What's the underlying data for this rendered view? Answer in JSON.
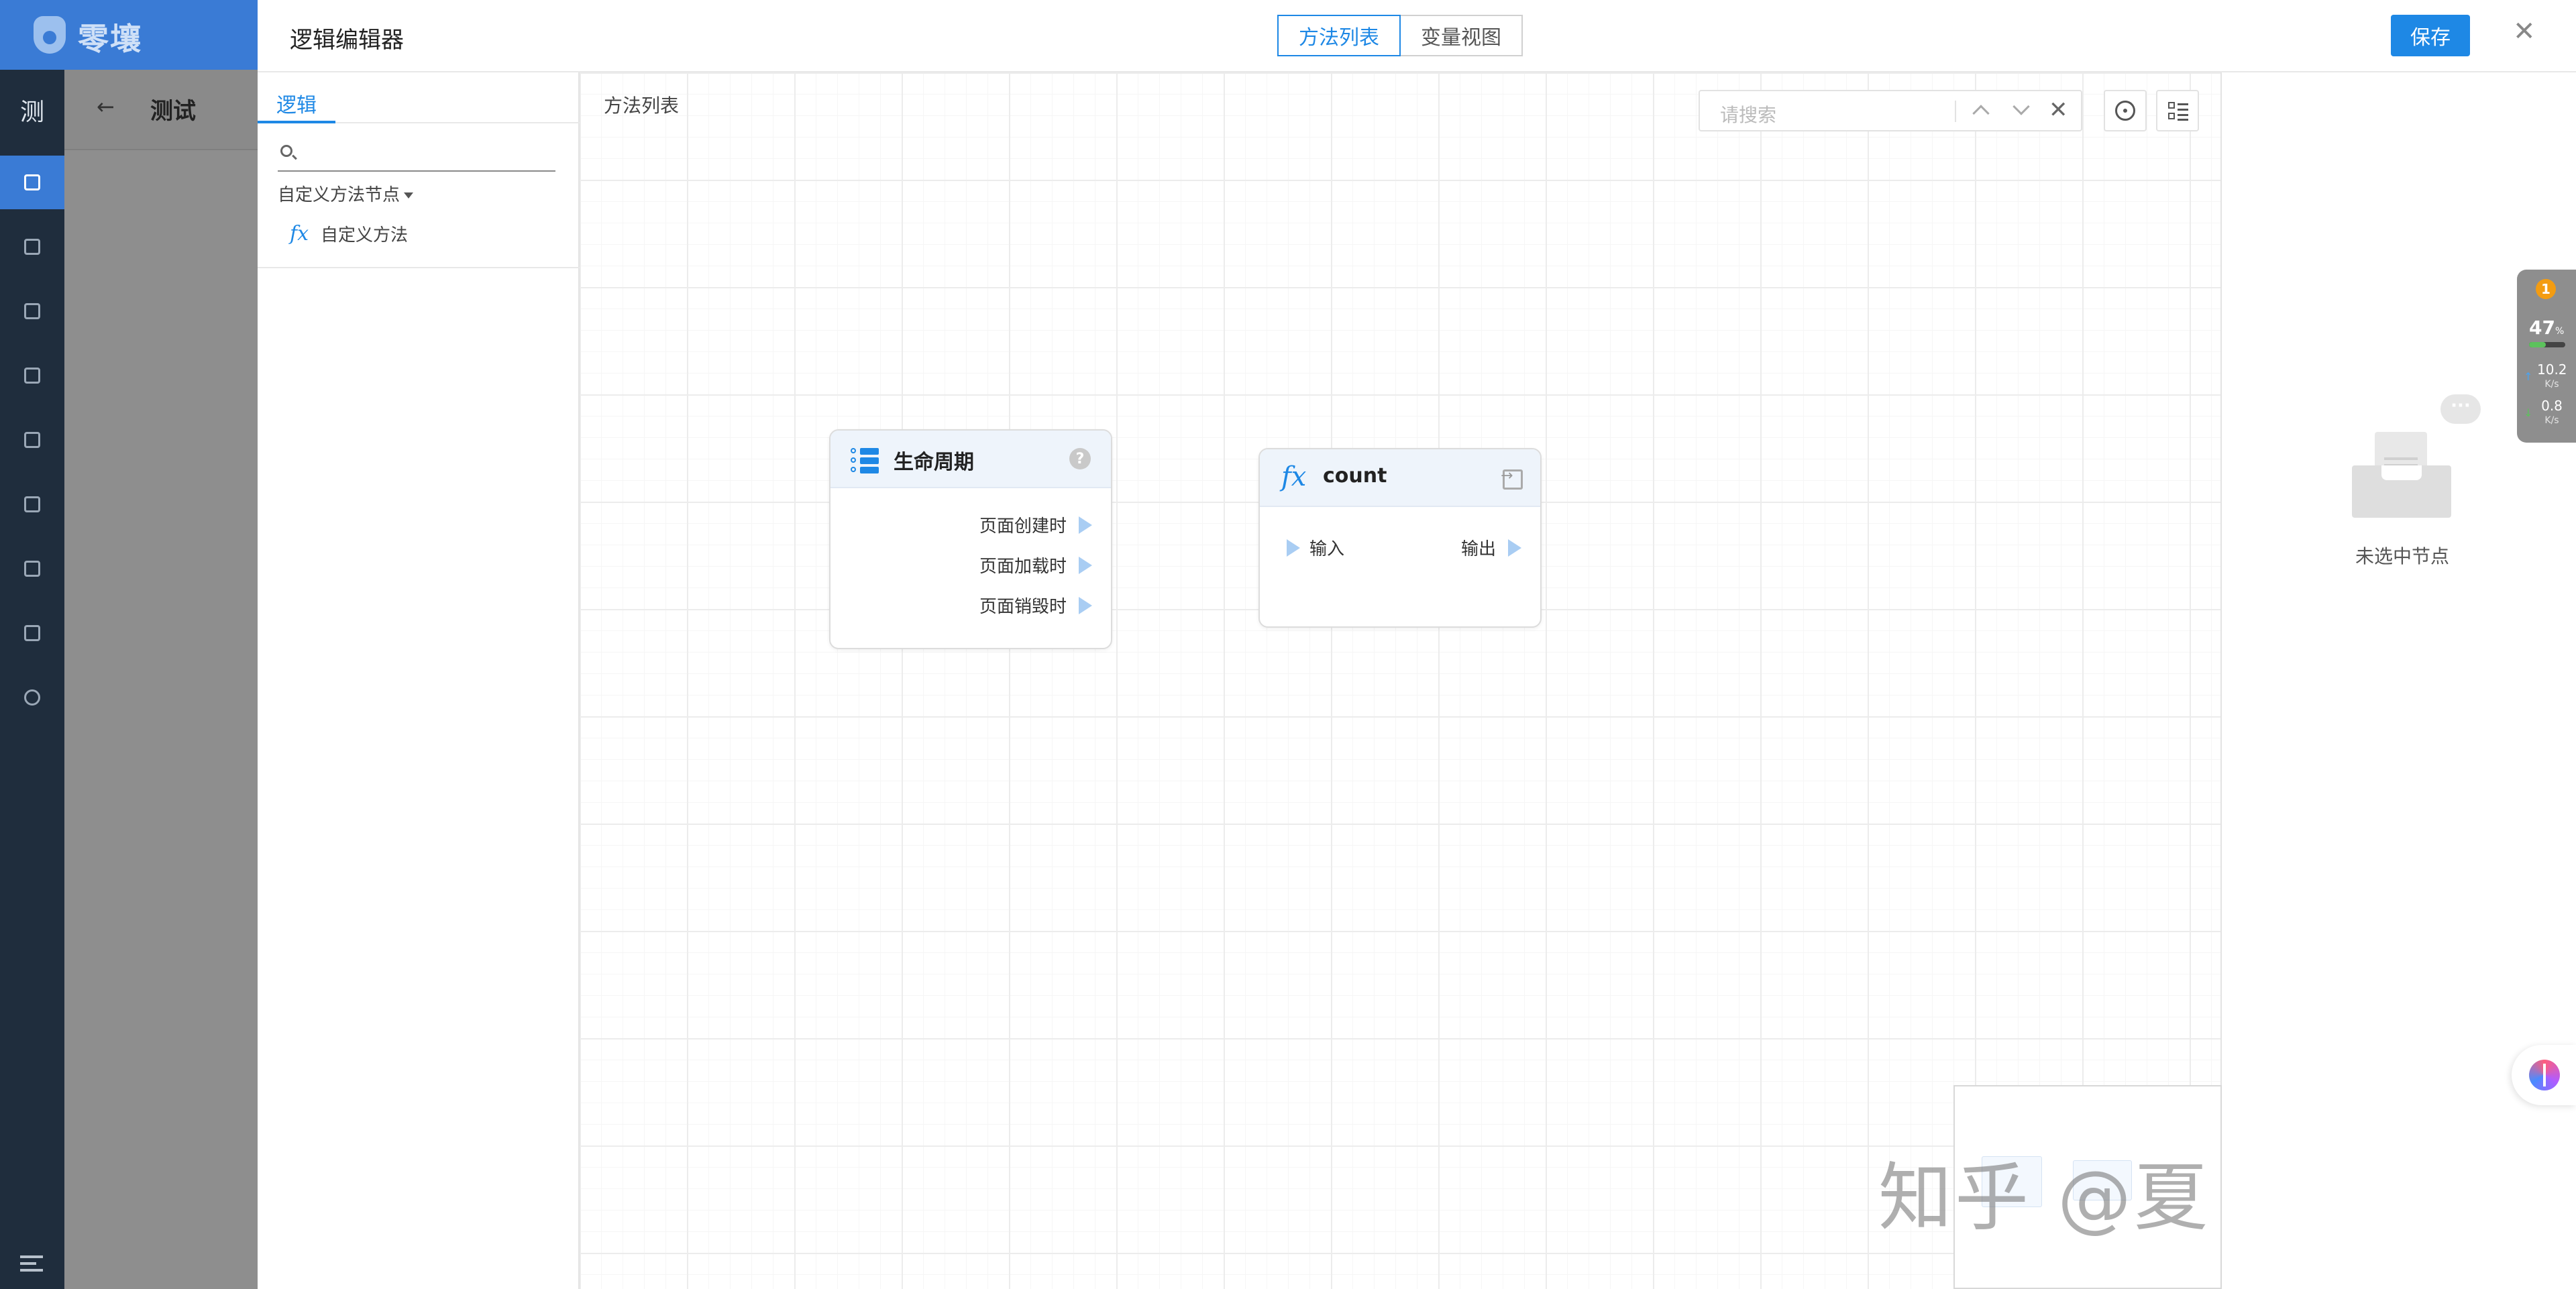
{
  "brand": {
    "name": "零壤"
  },
  "app_nav": {
    "initial": "测",
    "items": [
      "home-icon",
      "add-square-icon",
      "book-icon",
      "inbox-icon",
      "layers-icon",
      "apps-icon",
      "flow-icon",
      "doc-icon",
      "settings-icon"
    ],
    "active_index": 0,
    "collapse_icon": "menu-collapse-icon"
  },
  "behind_page": {
    "back_icon": "←",
    "title": "测试"
  },
  "editor": {
    "title": "逻辑编辑器",
    "view_tabs": [
      {
        "label": "方法列表",
        "active": true
      },
      {
        "label": "变量视图",
        "active": false
      }
    ],
    "save_label": "保存",
    "close_glyph": "✕"
  },
  "logic_panel": {
    "tab": "逻辑",
    "search": {
      "placeholder": "",
      "value": ""
    },
    "group_label": "自定义方法节点",
    "items": [
      {
        "icon": "fx",
        "label": "自定义方法"
      }
    ]
  },
  "canvas": {
    "label": "方法列表",
    "search": {
      "placeholder": "请搜索",
      "value": ""
    },
    "close_glyph": "✕",
    "nodes": {
      "lifecycle": {
        "title": "生命周期",
        "help_glyph": "?",
        "outputs": [
          "页面创建时",
          "页面加载时",
          "页面销毁时"
        ]
      },
      "count": {
        "icon": "fx",
        "title": "count",
        "input": "输入",
        "output": "输出"
      }
    }
  },
  "watermark": "知乎 @夏日奇妙夜",
  "right_panel": {
    "empty_text": "未选中节点",
    "chat_glyph": "···"
  },
  "system_widget": {
    "badge": "1",
    "percent": "47",
    "percent_unit": "%",
    "upload": "10.2",
    "download": "0.8",
    "rate_unit": "K/s",
    "level": 0.47
  },
  "colors": {
    "primary": "#1e88e5",
    "nav_bg": "#1f2d3d",
    "brand_bg": "#3a7bd5",
    "port": "#a9cdf3"
  }
}
